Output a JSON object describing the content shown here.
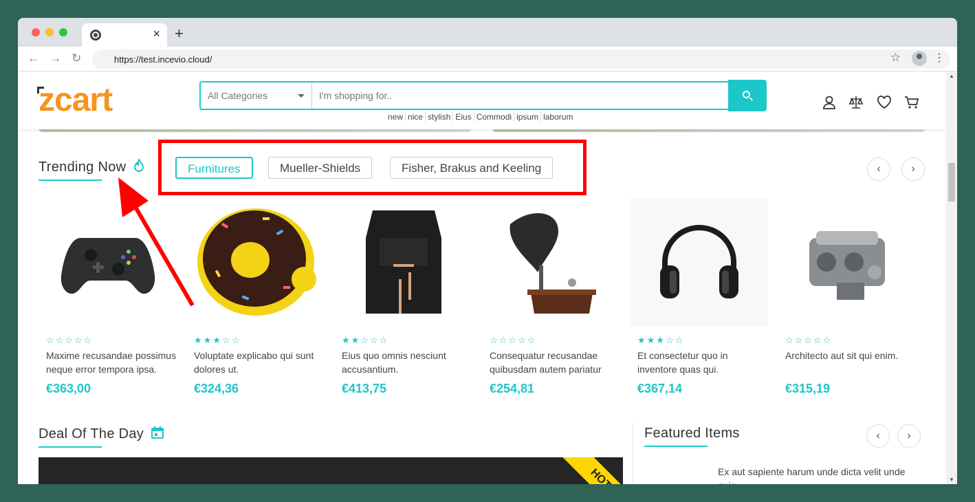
{
  "browser": {
    "tab_close": "×",
    "new_tab": "+",
    "url": "https://test.incevio.cloud/"
  },
  "header": {
    "logo_text": "zcart",
    "search": {
      "category": "All Categories",
      "placeholder": "I'm shopping for.."
    },
    "tags": [
      "new",
      "nice",
      "stylish",
      "Eius",
      "Commodi",
      "ipsum",
      "laborum"
    ]
  },
  "trending": {
    "title": "Trending Now",
    "chips": [
      {
        "label": "Furnitures",
        "active": true
      },
      {
        "label": "Mueller-Shields",
        "active": false
      },
      {
        "label": "Fisher, Brakus and Keeling",
        "active": false
      }
    ],
    "products": [
      {
        "image": "gamepad",
        "rating": 0,
        "name": "Maxime recusandae possimus neque error tempora ipsa.",
        "price": "€363,00"
      },
      {
        "image": "donut-float",
        "rating": 3,
        "name": "Voluptate explicabo qui sunt dolores ut.",
        "price": "€324,36"
      },
      {
        "image": "backpack",
        "rating": 2,
        "name": "Eius quo omnis nesciunt accusantium.",
        "price": "€413,75"
      },
      {
        "image": "gramophone",
        "rating": 0,
        "name": "Consequatur recusandae quibusdam autem pariatur",
        "price": "€254,81"
      },
      {
        "image": "headphones",
        "rating": 3,
        "name": "Et consectetur quo in inventore quas qui.",
        "price": "€367,14"
      },
      {
        "image": "engine",
        "rating": 0,
        "name": "Architecto aut sit qui enim.",
        "price": "€315,19"
      }
    ]
  },
  "deal": {
    "title": "Deal Of The Day",
    "badge": "HOT"
  },
  "featured": {
    "title": "Featured Items",
    "first_item": "Ex aut sapiente harum unde dicta velit unde quia"
  },
  "colors": {
    "accent": "#1ec7c7",
    "logo": "#f7941d",
    "annotation": "#ff0000"
  }
}
